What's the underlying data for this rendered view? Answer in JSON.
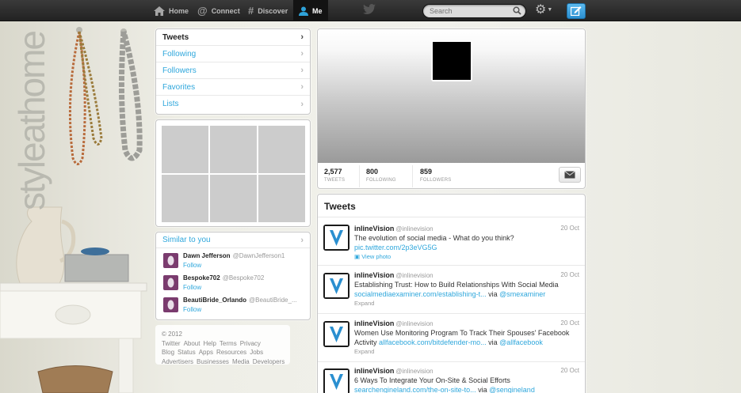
{
  "topbar": {
    "nav": [
      {
        "label": "Home",
        "icon": "home-icon"
      },
      {
        "label": "Connect",
        "icon": "at-icon"
      },
      {
        "label": "Discover",
        "icon": "hash-icon"
      },
      {
        "label": "Me",
        "icon": "person-icon"
      }
    ],
    "search_placeholder": "Search",
    "accent": "#2ea2d9"
  },
  "background": {
    "logo_text": "styleathome"
  },
  "side_nav": {
    "items": [
      {
        "label": "Tweets"
      },
      {
        "label": "Following"
      },
      {
        "label": "Followers"
      },
      {
        "label": "Favorites"
      },
      {
        "label": "Lists"
      }
    ]
  },
  "who_to_follow": {
    "title": "Similar to you",
    "items": [
      {
        "name": "Dawn Jefferson",
        "handle": "@DawnJefferson1",
        "follow": "Follow",
        "color": "#7a3b6e"
      },
      {
        "name": "Bespoke702",
        "handle": "@Bespoke702",
        "follow": "Follow",
        "color": "#7a3b6e"
      },
      {
        "name": "BeautiBride_Orlando",
        "handle": "@BeautiBride_...",
        "follow": "Follow",
        "color": "#7a3b6e"
      }
    ]
  },
  "footer": {
    "links": [
      "© 2012 Twitter",
      "About",
      "Help",
      "Terms",
      "Privacy",
      "Blog",
      "Status",
      "Apps",
      "Resources",
      "Jobs",
      "Advertisers",
      "Businesses",
      "Media",
      "Developers"
    ]
  },
  "profile": {
    "stats": [
      {
        "value": "2,577",
        "label": "TWEETS"
      },
      {
        "value": "800",
        "label": "FOLLOWING"
      },
      {
        "value": "859",
        "label": "FOLLOWERS"
      }
    ]
  },
  "tweets": {
    "title": "Tweets",
    "items": [
      {
        "name": "inlineVision",
        "handle": "@inlinevision",
        "date": "20 Oct",
        "text": "The evolution of social media - What do you think?",
        "link": "pic.twitter.com/2p3eVG5G",
        "via": "",
        "via_handle": "",
        "action": "View photo"
      },
      {
        "name": "inlineVision",
        "handle": "@inlinevision",
        "date": "20 Oct",
        "text": "Establishing Trust: How to Build Relationships With Social Media",
        "link": "socialmediaexaminer.com/establishing-t...",
        "via": "via",
        "via_handle": "@smexaminer",
        "action": "Expand"
      },
      {
        "name": "inlineVision",
        "handle": "@inlinevision",
        "date": "20 Oct",
        "text": "Women Use Monitoring Program To Track Their Spouses' Facebook Activity",
        "link": "allfacebook.com/bitdefender-mo...",
        "via": "via",
        "via_handle": "@allfacebook",
        "action": "Expand"
      },
      {
        "name": "inlineVision",
        "handle": "@inlinevision",
        "date": "20 Oct",
        "text": "6 Ways To Integrate Your On-Site & Social Efforts",
        "link": "searchengineland.com/the-on-site-to...",
        "via": "via",
        "via_handle": "@sengineland",
        "action": ""
      }
    ]
  }
}
